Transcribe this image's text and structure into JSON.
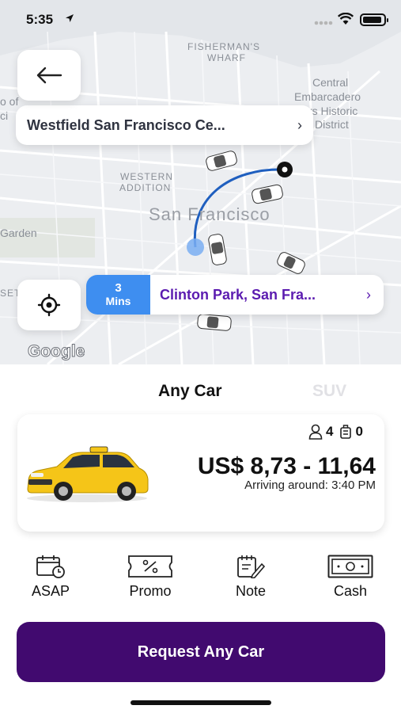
{
  "status_bar": {
    "time": "5:35"
  },
  "map": {
    "labels": {
      "fishermans": "FISHERMAN'S",
      "wharf": "WHARF",
      "central": "Central",
      "embarcadero": "Embarcadero",
      "historic": "rs Historic",
      "district": "District",
      "western": "WESTERN",
      "addition": "ADDITION",
      "city": "San Francisco",
      "garden": "Garden",
      "left_o": "o of",
      "left_ci": "ci",
      "left_set": "SET"
    },
    "google_logo": "Google"
  },
  "origin": {
    "text": "Westfield San Francisco Ce..."
  },
  "destination": {
    "eta_number": "3",
    "eta_unit": "Mins",
    "text": "Clinton Park, San Fra..."
  },
  "tabs": [
    {
      "label": "Any Car",
      "active": true
    },
    {
      "label": "SUV",
      "active": false
    }
  ],
  "ride": {
    "passengers": "4",
    "luggage": "0",
    "price": "US$ 8,73 -  11,64",
    "arriving": "Arriving around: 3:40 PM"
  },
  "options": [
    {
      "label": "ASAP",
      "icon": "calendar-clock-icon"
    },
    {
      "label": "Promo",
      "icon": "coupon-icon"
    },
    {
      "label": "Note",
      "icon": "note-icon"
    },
    {
      "label": "Cash",
      "icon": "cash-icon"
    }
  ],
  "request_button": "Request Any Car",
  "colors": {
    "primary": "#410a6f",
    "eta": "#3e8ef0",
    "destination_text": "#5b1bb0",
    "taxi": "#f5c518"
  }
}
